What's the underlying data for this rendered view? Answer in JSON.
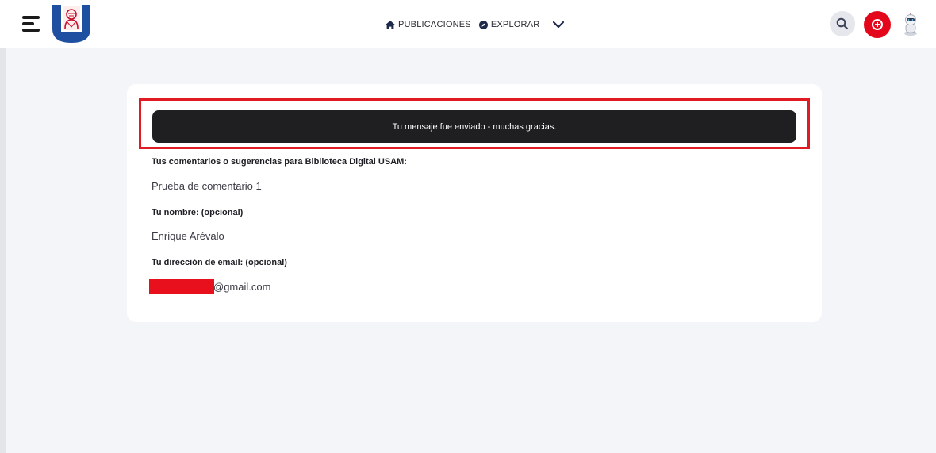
{
  "header": {
    "nav": [
      {
        "icon": "home-icon",
        "label": "PUBLICACIONES"
      },
      {
        "icon": "compass-icon",
        "label": "EXPLORAR"
      }
    ]
  },
  "colors": {
    "accent_red": "#e4061a",
    "brand_blue": "#1f4fa0",
    "alert_bg": "#1f1f22",
    "page_bg": "#f4f5f8"
  },
  "alert": {
    "message": "Tu mensaje fue enviado - muchas gracias."
  },
  "form": {
    "comments_label": "Tus comentarios o sugerencias para Biblioteca Digital USAM:",
    "comments_value": "Prueba de comentario 1",
    "name_label": "Tu nombre: (opcional)",
    "name_value": "Enrique Arévalo",
    "email_label": "Tu dirección de email: (opcional)",
    "email_value_visible": "@gmail.com"
  }
}
